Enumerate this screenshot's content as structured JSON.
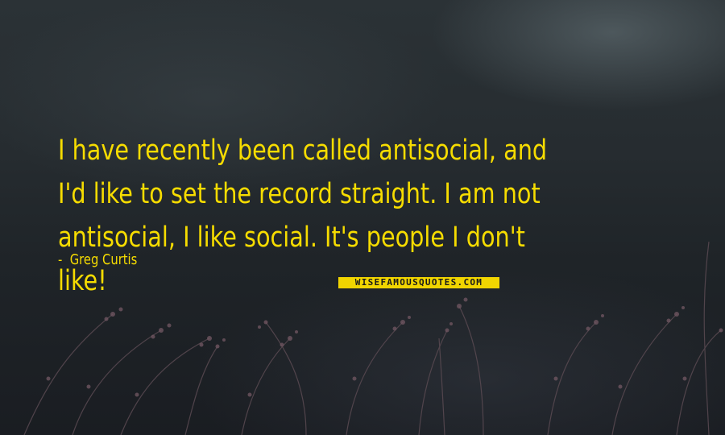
{
  "quote": {
    "text": "I have recently been called antisocial, and I'd like to set the record straight. I am not antisocial, I like social. It's people I don't like!",
    "author": "Greg Curtis"
  },
  "watermark": {
    "text": "WISEFAMOUSQUOTES.COM"
  },
  "colors": {
    "text": "#f6dc00",
    "logo_background": "#f1d500",
    "background": "#23292d"
  }
}
